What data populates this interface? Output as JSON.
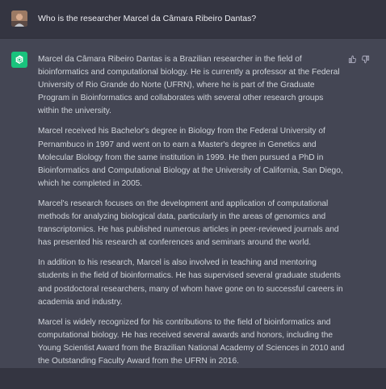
{
  "user_message": {
    "text": "Who is the researcher Marcel da Câmara Ribeiro Dantas?",
    "avatar_icon": "user-avatar-photo"
  },
  "assistant_message": {
    "avatar_icon": "openai-logo-icon",
    "avatar_color": "#19c37d",
    "paragraphs": [
      "Marcel da Câmara Ribeiro Dantas is a Brazilian researcher in the field of bioinformatics and computational biology. He is currently a professor at the Federal University of Rio Grande do Norte (UFRN), where he is part of the Graduate Program in Bioinformatics and collaborates with several other research groups within the university.",
      "Marcel received his Bachelor's degree in Biology from the Federal University of Pernambuco in 1997 and went on to earn a Master's degree in Genetics and Molecular Biology from the same institution in 1999. He then pursued a PhD in Bioinformatics and Computational Biology at the University of California, San Diego, which he completed in 2005.",
      "Marcel's research focuses on the development and application of computational methods for analyzing biological data, particularly in the areas of genomics and transcriptomics. He has published numerous articles in peer-reviewed journals and has presented his research at conferences and seminars around the world.",
      "In addition to his research, Marcel is also involved in teaching and mentoring students in the field of bioinformatics. He has supervised several graduate students and postdoctoral researchers, many of whom have gone on to successful careers in academia and industry.",
      "Marcel is widely recognized for his contributions to the field of bioinformatics and computational biology. He has received several awards and honors, including the Young Scientist Award from the Brazilian National Academy of Sciences in 2010 and the Outstanding Faculty Award from the UFRN in 2016."
    ],
    "feedback_icons": [
      "thumbs-up-icon",
      "thumbs-down-icon"
    ]
  },
  "colors": {
    "user_background": "#343541",
    "assistant_background": "#444654",
    "text": "#d1d5db"
  }
}
